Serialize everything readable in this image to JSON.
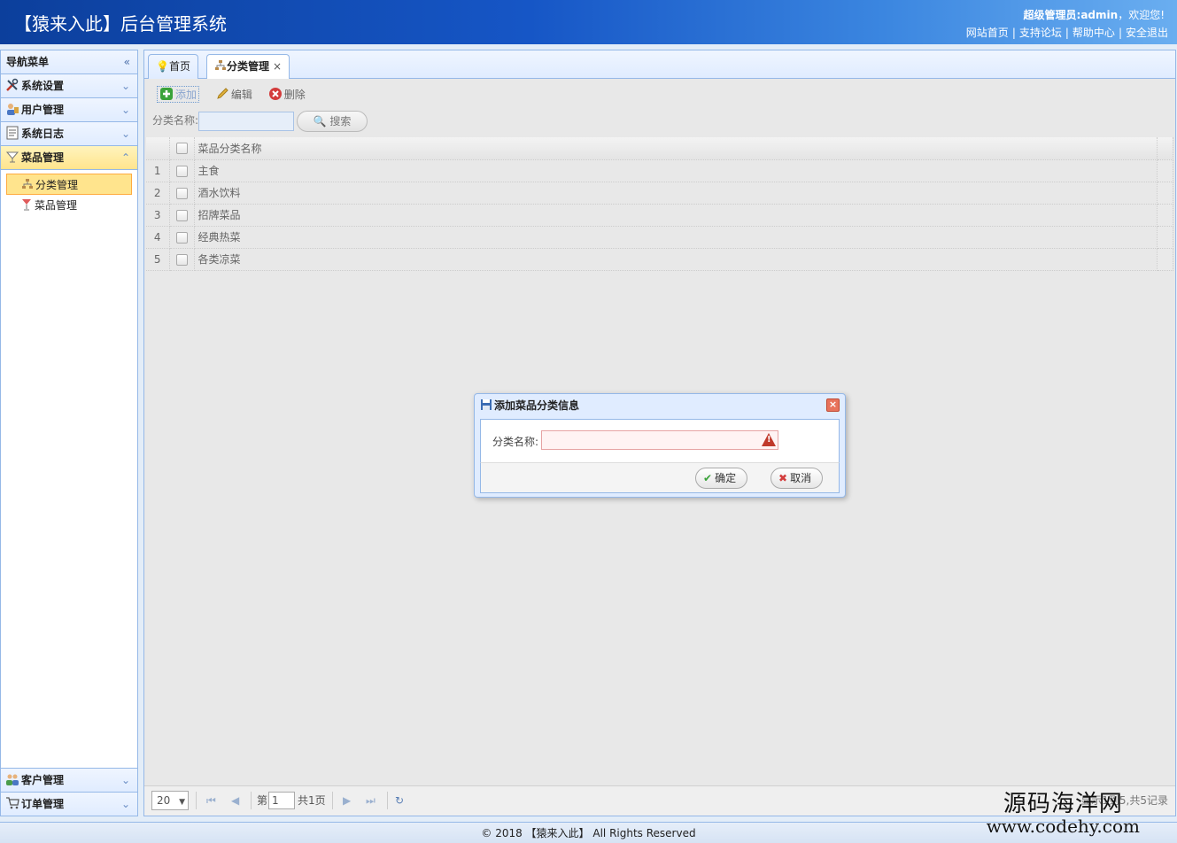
{
  "header": {
    "title": "【猿来入此】后台管理系统",
    "user_prefix": "超级管理员:admin",
    "user_suffix": "，欢迎您!",
    "links": [
      "网站首页",
      "支持论坛",
      "帮助中心",
      "安全退出"
    ],
    "link_separator": "|"
  },
  "nav": {
    "title": "导航菜单",
    "collapse_glyph": "«",
    "sections": [
      {
        "label": "系统设置",
        "icon": "tools-icon",
        "state": "collapsed"
      },
      {
        "label": "用户管理",
        "icon": "users-icon",
        "state": "collapsed"
      },
      {
        "label": "系统日志",
        "icon": "log-icon",
        "state": "collapsed"
      },
      {
        "label": "菜品管理",
        "icon": "dish-icon",
        "state": "expanded"
      }
    ],
    "subitems": [
      {
        "label": "分类管理",
        "icon": "category-icon",
        "selected": true
      },
      {
        "label": "菜品管理",
        "icon": "wine-glass-icon",
        "selected": false
      }
    ],
    "bottom_sections": [
      {
        "label": "客户管理",
        "icon": "customers-icon"
      },
      {
        "label": "订单管理",
        "icon": "cart-icon"
      }
    ]
  },
  "tabs": [
    {
      "label": "首页",
      "icon": "bulb-icon",
      "active": false
    },
    {
      "label": "分类管理",
      "icon": "category-icon",
      "active": true,
      "close": "×"
    }
  ],
  "toolbar": {
    "add": "添加",
    "edit": "编辑",
    "delete": "删除"
  },
  "search": {
    "label": "分类名称:",
    "value": "",
    "button": "搜索"
  },
  "grid": {
    "column": "菜品分类名称",
    "rows": [
      {
        "num": "1",
        "name": "主食"
      },
      {
        "num": "2",
        "name": "酒水饮料"
      },
      {
        "num": "3",
        "name": "招牌菜品"
      },
      {
        "num": "4",
        "name": "经典热菜"
      },
      {
        "num": "5",
        "name": "各类凉菜"
      }
    ]
  },
  "pager": {
    "page_size": "20",
    "page_prefix": "第",
    "page_value": "1",
    "page_total": "共1页",
    "info": "显示1到5,共5记录"
  },
  "dialog": {
    "title": "添加菜品分类信息",
    "field_label": "分类名称:",
    "field_value": "",
    "ok": "确定",
    "cancel": "取消",
    "close": "×"
  },
  "footer": {
    "text": "© 2018 【猿来入此】 All Rights Reserved"
  },
  "watermark": {
    "line1": "源码海洋网",
    "line2": "www.codehy.com"
  },
  "colors": {
    "header_start": "#0c3f9c",
    "accent_border": "#95b8e7",
    "selected_bg": "#ffe48d",
    "danger": "#c0392b"
  }
}
